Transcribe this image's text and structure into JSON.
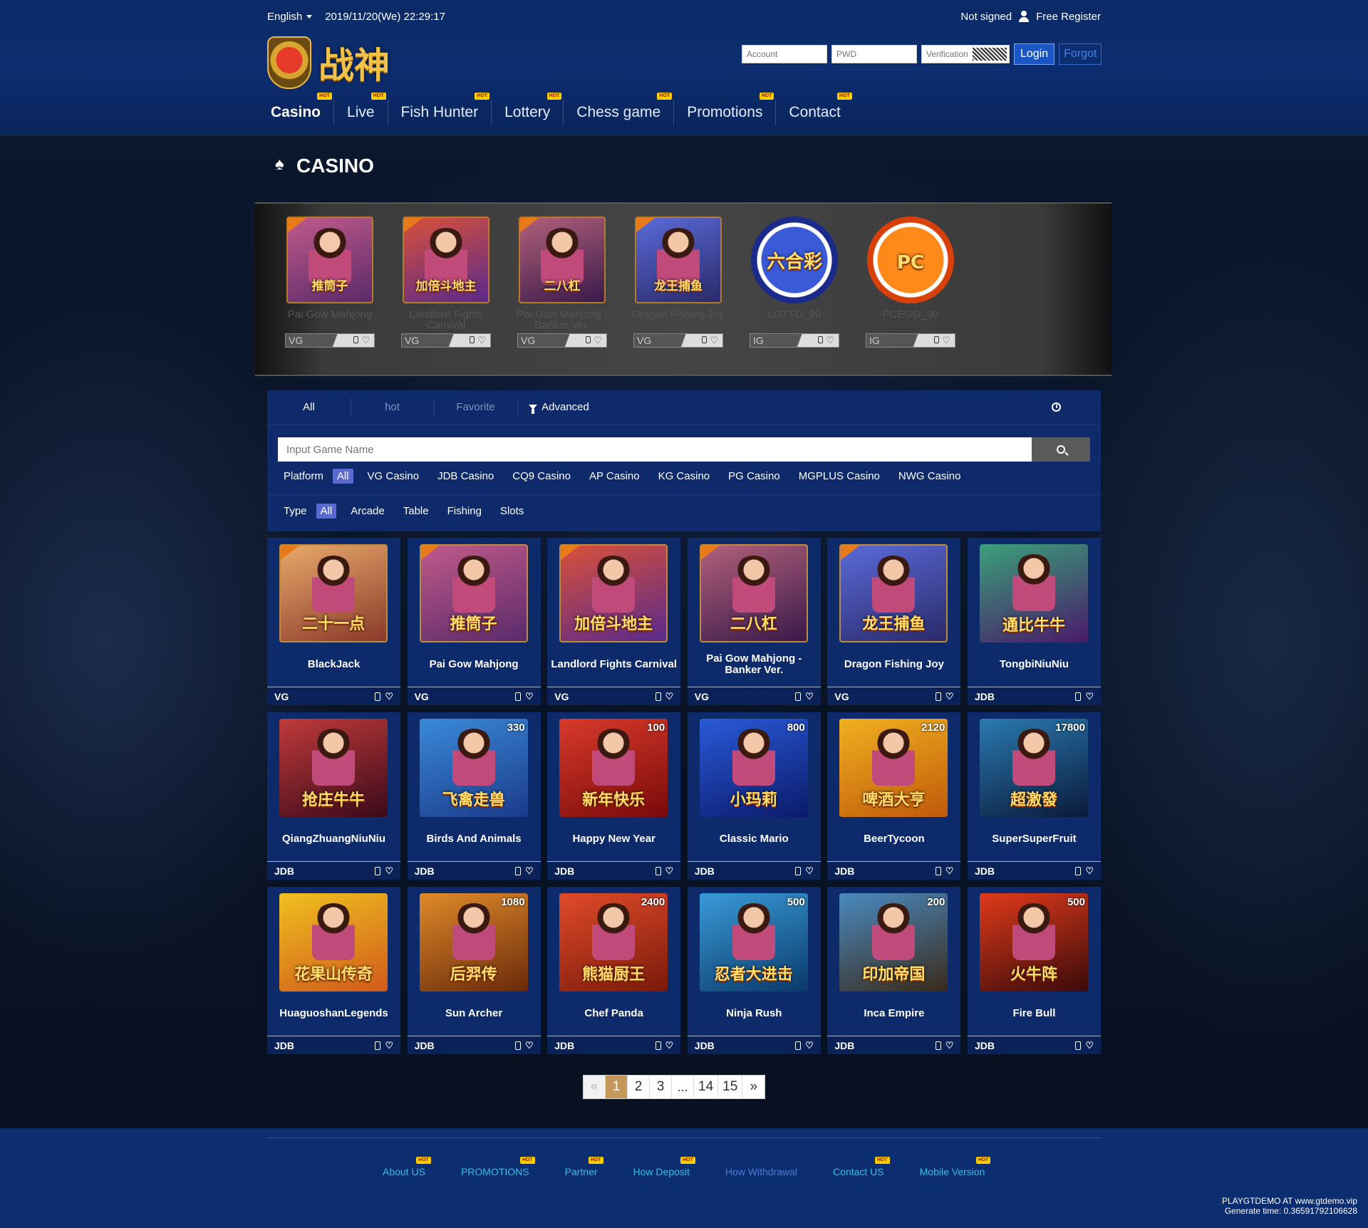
{
  "topbar": {
    "language": "English",
    "datetime": "2019/11/20(We) 22:29:17",
    "status": "Not signed",
    "register": "Free Register"
  },
  "brand": {
    "name": "战神"
  },
  "login": {
    "account_placeholder": "Account",
    "pwd_placeholder": "PWD",
    "verification_placeholder": "Verification",
    "login_label": "Login",
    "forgot_label": "Forgot"
  },
  "nav": {
    "hot_badge": "HOT",
    "items": [
      {
        "label": "Casino"
      },
      {
        "label": "Live"
      },
      {
        "label": "Fish Hunter"
      },
      {
        "label": "Lottery"
      },
      {
        "label": "Chess game"
      },
      {
        "label": "Promotions"
      },
      {
        "label": "Contact"
      }
    ]
  },
  "section": {
    "title": "CASINO"
  },
  "featured": [
    {
      "name": "Pai Gow Mahjong",
      "platform": "VG",
      "art": "推筒子",
      "colors": [
        "#c05a8a",
        "#5a2a6a"
      ]
    },
    {
      "name": "Landlord Fights Carnival",
      "platform": "VG",
      "art": "加倍斗地主",
      "colors": [
        "#d8503a",
        "#5a2a8a"
      ]
    },
    {
      "name": "Pai Gow Mahjong - Banker Ver.",
      "platform": "VG",
      "art": "二八杠",
      "colors": [
        "#b0607a",
        "#3a1a4a"
      ]
    },
    {
      "name": "Dragon Fishing Joy",
      "platform": "VG",
      "art": "龙王捕鱼",
      "colors": [
        "#5a6ad8",
        "#2a2a6a"
      ]
    },
    {
      "name": "LOTTO_90",
      "platform": "IG",
      "art": "六合彩",
      "colors": [
        "#3a5ad8",
        "#1a2a8a"
      ]
    },
    {
      "name": "PCEGG_90",
      "platform": "IG",
      "art": "PC",
      "colors": [
        "#ff8a1a",
        "#d8400a"
      ]
    }
  ],
  "tabs": {
    "all": "All",
    "hot": "hot",
    "favorite": "Favorite",
    "advanced": "Advanced"
  },
  "search": {
    "placeholder": "Input Game Name"
  },
  "platform_filter": {
    "label": "Platform",
    "options": [
      "All",
      "VG Casino",
      "JDB Casino",
      "CQ9 Casino",
      "AP Casino",
      "KG Casino",
      "PG Casino",
      "MGPLUS Casino",
      "NWG Casino"
    ]
  },
  "type_filter": {
    "label": "Type",
    "options": [
      "All",
      "Arcade",
      "Table",
      "Fishing",
      "Slots"
    ]
  },
  "games": [
    {
      "name": "BlackJack",
      "platform": "VG",
      "art": "二十一点",
      "jackpot": "",
      "colors": [
        "#e8a86a",
        "#8a3a2a"
      ]
    },
    {
      "name": "Pai Gow Mahjong",
      "platform": "VG",
      "art": "推筒子",
      "jackpot": "",
      "colors": [
        "#c05a8a",
        "#5a2a6a"
      ]
    },
    {
      "name": "Landlord Fights Carnival",
      "platform": "VG",
      "art": "加倍斗地主",
      "jackpot": "",
      "colors": [
        "#d8503a",
        "#5a2a8a"
      ]
    },
    {
      "name": "Pai Gow Mahjong - Banker Ver.",
      "platform": "VG",
      "art": "二八杠",
      "jackpot": "",
      "colors": [
        "#b0607a",
        "#3a1a4a"
      ]
    },
    {
      "name": "Dragon Fishing Joy",
      "platform": "VG",
      "art": "龙王捕鱼",
      "jackpot": "",
      "colors": [
        "#5a6ad8",
        "#2a2a6a"
      ]
    },
    {
      "name": "TongbiNiuNiu",
      "platform": "JDB",
      "art": "通比牛牛",
      "jackpot": "",
      "colors": [
        "#3aa07a",
        "#4a1a6a"
      ]
    },
    {
      "name": "QiangZhuangNiuNiu",
      "platform": "JDB",
      "art": "抢庄牛牛",
      "jackpot": "",
      "colors": [
        "#c03a3a",
        "#3a0a1a"
      ]
    },
    {
      "name": "Birds And Animals",
      "platform": "JDB",
      "art": "飞禽走兽",
      "jackpot": "330",
      "colors": [
        "#3a8ad8",
        "#1a3a8a"
      ]
    },
    {
      "name": "Happy New Year",
      "platform": "JDB",
      "art": "新年快乐",
      "jackpot": "100",
      "colors": [
        "#d83a2a",
        "#7a0a0a"
      ]
    },
    {
      "name": "Classic Mario",
      "platform": "JDB",
      "art": "小玛莉",
      "jackpot": "800",
      "colors": [
        "#2a5ad8",
        "#0a1a6a"
      ]
    },
    {
      "name": "BeerTycoon",
      "platform": "JDB",
      "art": "啤酒大亨",
      "jackpot": "2120",
      "colors": [
        "#f0b020",
        "#c05a0a"
      ]
    },
    {
      "name": "SuperSuperFruit",
      "platform": "JDB",
      "art": "超激發",
      "jackpot": "17800",
      "colors": [
        "#2a7ab0",
        "#0a1a3a"
      ]
    },
    {
      "name": "HuaguoshanLegends",
      "platform": "JDB",
      "art": "花果山传奇",
      "jackpot": "",
      "colors": [
        "#f0c020",
        "#d05a1a"
      ]
    },
    {
      "name": "Sun Archer",
      "platform": "JDB",
      "art": "后羿传",
      "jackpot": "1080",
      "colors": [
        "#e08a2a",
        "#6a2a0a"
      ]
    },
    {
      "name": "Chef Panda",
      "platform": "JDB",
      "art": "熊猫厨王",
      "jackpot": "2400",
      "colors": [
        "#e04a2a",
        "#7a1a0a"
      ]
    },
    {
      "name": "Ninja Rush",
      "platform": "JDB",
      "art": "忍者大进击",
      "jackpot": "500",
      "colors": [
        "#3a9ad8",
        "#0a3a6a"
      ]
    },
    {
      "name": "Inca Empire",
      "platform": "JDB",
      "art": "印加帝国",
      "jackpot": "200",
      "colors": [
        "#4a8ac0",
        "#3a2a1a"
      ]
    },
    {
      "name": "Fire Bull",
      "platform": "JDB",
      "art": "火牛阵",
      "jackpot": "500",
      "colors": [
        "#e03a1a",
        "#3a0a0a"
      ]
    }
  ],
  "pagination": {
    "prev": "«",
    "pages": [
      "1",
      "2",
      "3"
    ],
    "ellipsis": "...",
    "last_pages": [
      "14",
      "15"
    ],
    "next": "»",
    "current": 1
  },
  "footer": {
    "links": [
      {
        "label": "About US",
        "hot": true,
        "dim": false
      },
      {
        "label": "PROMOTIONS",
        "hot": true,
        "dim": false
      },
      {
        "label": "Partner",
        "hot": true,
        "dim": false
      },
      {
        "label": "How Deposit",
        "hot": true,
        "dim": false
      },
      {
        "label": "How Withdrawal",
        "hot": false,
        "dim": true
      },
      {
        "label": "Contact US",
        "hot": true,
        "dim": false
      },
      {
        "label": "Mobile Version",
        "hot": true,
        "dim": false
      }
    ],
    "site": "PLAYGTDEMO AT www.gtdemo.vip",
    "generate": "Generate time: 0.36591792106628"
  }
}
